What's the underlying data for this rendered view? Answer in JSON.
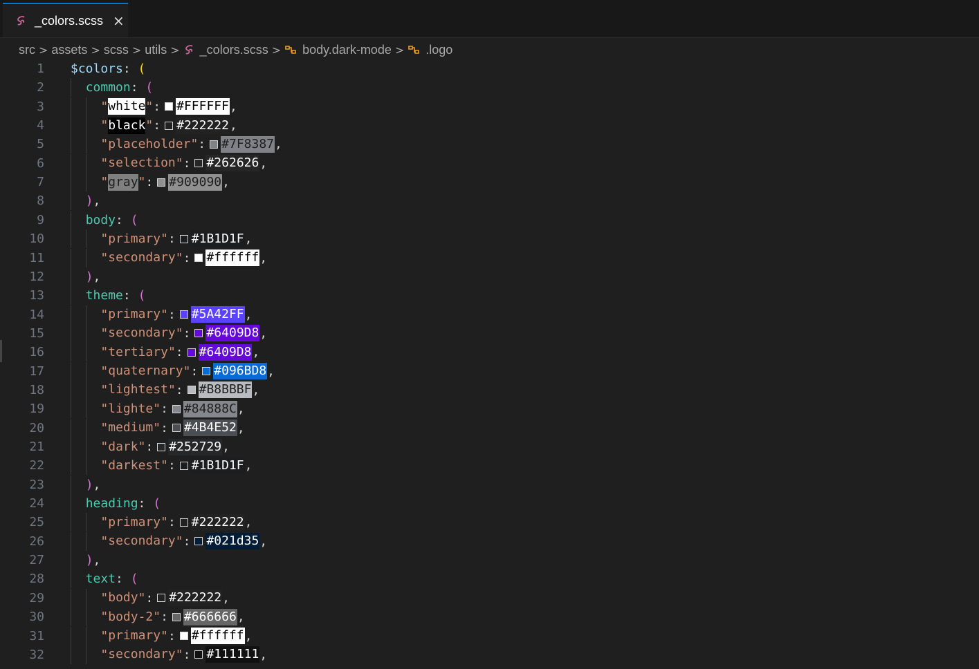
{
  "tab": {
    "label": "_colors.scss",
    "close": "×"
  },
  "breadcrumb": {
    "items": [
      "src",
      "assets",
      "scss",
      "utils",
      "_colors.scss",
      "body.dark-mode",
      ".logo"
    ],
    "separator": ">"
  },
  "code_lines": [
    {
      "n": "1",
      "tokens": [
        [
          "var",
          "$colors"
        ],
        [
          "punc",
          ": "
        ],
        [
          "paren1",
          "("
        ]
      ]
    },
    {
      "n": "2",
      "tokens": [
        [
          "key",
          "common"
        ],
        [
          "punc",
          ": "
        ],
        [
          "paren2",
          "("
        ]
      ]
    },
    {
      "n": "3",
      "key": "white",
      "hex": "#FFFFFF",
      "swatch": "#FFFFFF",
      "hexbg": "#FFFFFF",
      "hexfg": "#000000",
      "keybg": "#FFFFFF",
      "keyfg": "#000000"
    },
    {
      "n": "4",
      "key": "black",
      "hex": "#222222",
      "swatch": "#222222",
      "hexbg": "#222222",
      "hexfg": "#FFFFFF",
      "keybg": "#000000",
      "keyfg": "#FFFFFF"
    },
    {
      "n": "5",
      "key": "placeholder",
      "hex": "#7F8387",
      "swatch": "#7F8387",
      "hexbg": "#7F8387",
      "hexfg": "#1f1f1f"
    },
    {
      "n": "6",
      "key": "selection",
      "hex": "#262626",
      "swatch": "#262626",
      "hexbg": "#262626",
      "hexfg": "#FFFFFF"
    },
    {
      "n": "7",
      "key": "gray",
      "hex": "#909090",
      "swatch": "#909090",
      "hexbg": "#909090",
      "hexfg": "#1f1f1f",
      "keybg": "#808080",
      "keyfg": "#1f1f1f"
    },
    {
      "n": "8",
      "tokens": [
        [
          "paren2",
          ")"
        ],
        [
          "punc",
          ","
        ]
      ]
    },
    {
      "n": "9",
      "tokens": [
        [
          "key",
          "body"
        ],
        [
          "punc",
          ": "
        ],
        [
          "paren2",
          "("
        ]
      ]
    },
    {
      "n": "10",
      "key": "primary",
      "hex": "#1B1D1F",
      "swatch": "#1B1D1F",
      "hexbg": "#1B1D1F",
      "hexfg": "#FFFFFF"
    },
    {
      "n": "11",
      "key": "secondary",
      "hex": "#ffffff",
      "swatch": "#ffffff",
      "hexbg": "#ffffff",
      "hexfg": "#000000"
    },
    {
      "n": "12",
      "tokens": [
        [
          "paren2",
          ")"
        ],
        [
          "punc",
          ","
        ]
      ]
    },
    {
      "n": "13",
      "tokens": [
        [
          "key",
          "theme"
        ],
        [
          "punc",
          ": "
        ],
        [
          "paren2",
          "("
        ]
      ]
    },
    {
      "n": "14",
      "key": "primary",
      "hex": "#5A42FF",
      "swatch": "#5A42FF",
      "hexbg": "#5A42FF",
      "hexfg": "#FFFFFF"
    },
    {
      "n": "15",
      "key": "secondary",
      "hex": "#6409D8",
      "swatch": "#6409D8",
      "hexbg": "#6409D8",
      "hexfg": "#FFFFFF"
    },
    {
      "n": "16",
      "key": "tertiary",
      "hex": "#6409D8",
      "swatch": "#6409D8",
      "hexbg": "#6409D8",
      "hexfg": "#FFFFFF"
    },
    {
      "n": "17",
      "key": "quaternary",
      "hex": "#096BD8",
      "swatch": "#096BD8",
      "hexbg": "#096BD8",
      "hexfg": "#FFFFFF"
    },
    {
      "n": "18",
      "key": "lightest",
      "hex": "#B8BBBF",
      "swatch": "#B8BBBF",
      "hexbg": "#B8BBBF",
      "hexfg": "#1f1f1f"
    },
    {
      "n": "19",
      "key": "lighte",
      "hex": "#84888C",
      "swatch": "#84888C",
      "hexbg": "#84888C",
      "hexfg": "#1f1f1f"
    },
    {
      "n": "20",
      "key": "medium",
      "hex": "#4B4E52",
      "swatch": "#4B4E52",
      "hexbg": "#4B4E52",
      "hexfg": "#FFFFFF"
    },
    {
      "n": "21",
      "key": "dark",
      "hex": "#252729",
      "swatch": "#252729",
      "hexbg": "#252729",
      "hexfg": "#FFFFFF"
    },
    {
      "n": "22",
      "key": "darkest",
      "hex": "#1B1D1F",
      "swatch": "#1B1D1F",
      "hexbg": "#1B1D1F",
      "hexfg": "#FFFFFF"
    },
    {
      "n": "23",
      "tokens": [
        [
          "paren2",
          ")"
        ],
        [
          "punc",
          ","
        ]
      ]
    },
    {
      "n": "24",
      "tokens": [
        [
          "key",
          "heading"
        ],
        [
          "punc",
          ": "
        ],
        [
          "paren2",
          "("
        ]
      ]
    },
    {
      "n": "25",
      "key": "primary",
      "hex": "#222222",
      "swatch": "#222222",
      "hexbg": "#222222",
      "hexfg": "#FFFFFF"
    },
    {
      "n": "26",
      "key": "secondary",
      "hex": "#021d35",
      "swatch": "#021d35",
      "hexbg": "#021d35",
      "hexfg": "#FFFFFF"
    },
    {
      "n": "27",
      "tokens": [
        [
          "paren2",
          ")"
        ],
        [
          "punc",
          ","
        ]
      ]
    },
    {
      "n": "28",
      "tokens": [
        [
          "key",
          "text"
        ],
        [
          "punc",
          ": "
        ],
        [
          "paren2",
          "("
        ]
      ]
    },
    {
      "n": "29",
      "key": "body",
      "hex": "#222222",
      "swatch": "#222222",
      "hexbg": "#222222",
      "hexfg": "#FFFFFF"
    },
    {
      "n": "30",
      "key": "body-2",
      "hex": "#666666",
      "swatch": "#666666",
      "hexbg": "#666666",
      "hexfg": "#FFFFFF"
    },
    {
      "n": "31",
      "key": "primary",
      "hex": "#ffffff",
      "swatch": "#ffffff",
      "hexbg": "#ffffff",
      "hexfg": "#000000"
    },
    {
      "n": "32",
      "key": "secondary",
      "hex": "#111111",
      "swatch": "#111111",
      "hexbg": "#111111",
      "hexfg": "#FFFFFF"
    }
  ],
  "colors": {
    "accent": "#0078d4",
    "editor_bg": "#1f1f1f",
    "tabbar_bg": "#181818",
    "sass_icon": "#cd6799",
    "symbol_icon": "#ee9d28"
  }
}
